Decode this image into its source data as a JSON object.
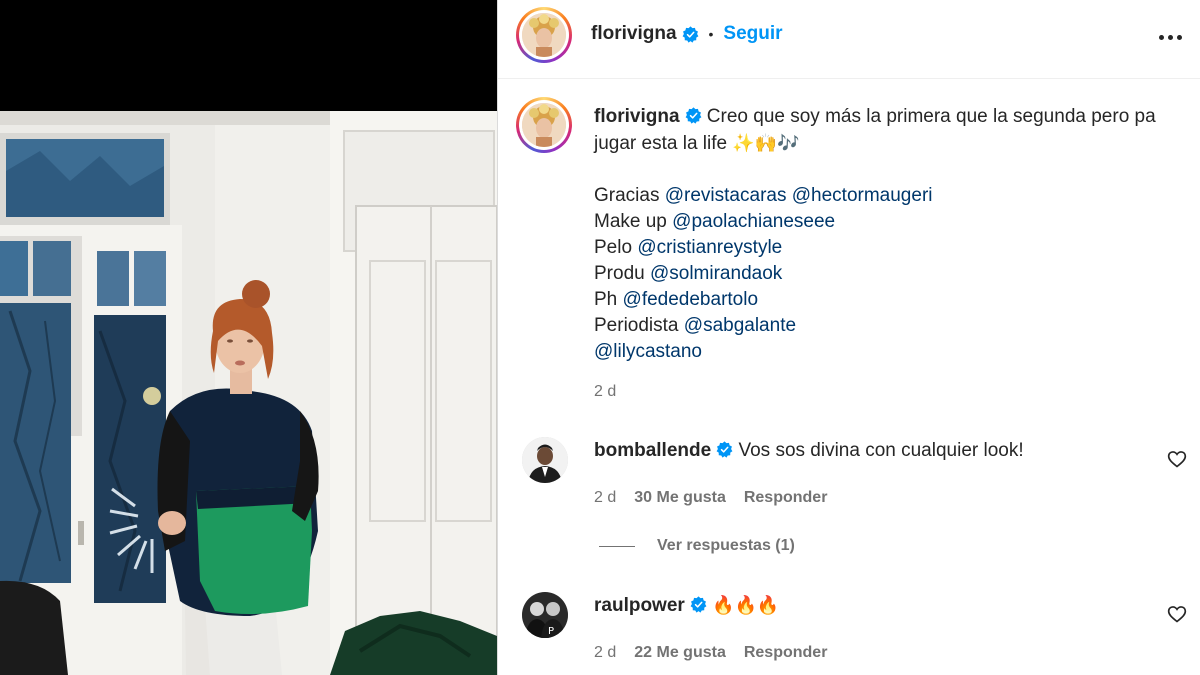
{
  "header": {
    "username": "florivigna",
    "separator": "•",
    "follow_label": "Seguir"
  },
  "caption": {
    "username": "florivigna",
    "text": "Creo que soy más la primera que la segunda pero pa jugar esta la life",
    "emojis": "✨🙌🎶",
    "credits": [
      {
        "label": "Gracias",
        "mentions": [
          "@revistacaras",
          "@hectormaugeri"
        ]
      },
      {
        "label": "Make up",
        "mentions": [
          "@paolachianeseee"
        ]
      },
      {
        "label": "Pelo",
        "mentions": [
          "@cristianreystyle"
        ]
      },
      {
        "label": "Produ",
        "mentions": [
          "@solmirandaok"
        ]
      },
      {
        "label": "Ph",
        "mentions": [
          "@fededebartolo"
        ]
      },
      {
        "label": "Periodista",
        "mentions": [
          "@sabgalante"
        ]
      },
      {
        "label": "",
        "mentions": [
          "@lilycastano"
        ]
      }
    ],
    "time": "2 d"
  },
  "comments": [
    {
      "username": "bomballende",
      "verified": true,
      "text": "Vos sos divina con cualquier look!",
      "time": "2 d",
      "likes": "30 Me gusta",
      "reply": "Responder",
      "view_replies": "Ver respuestas (1)"
    },
    {
      "username": "raulpower",
      "verified": true,
      "text": "🔥🔥🔥",
      "time": "2 d",
      "likes": "22 Me gusta",
      "reply": "Responder"
    }
  ],
  "colors": {
    "link_blue": "#0095f6",
    "mention": "#00376b",
    "verified": "#0095f6",
    "muted": "#737373"
  },
  "icons": [
    "verified-badge-icon",
    "more-options-icon",
    "heart-icon"
  ]
}
